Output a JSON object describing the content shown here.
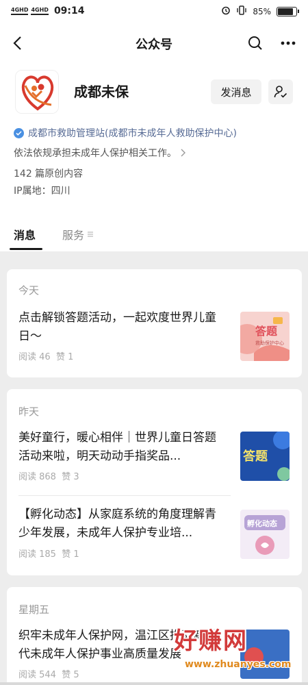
{
  "status": {
    "signal1": "4GHD",
    "signal2": "4GHD",
    "time": "09:14",
    "battery": "85%",
    "battery_level": 0.85
  },
  "nav": {
    "title": "公众号"
  },
  "profile": {
    "name": "成都未保",
    "message_button": "发消息",
    "verified_org": "成都市救助管理站(成都市未成年人救助保护中心)",
    "description": "依法依规承担未成年人保护相关工作。",
    "original_count": "142 篇原创内容",
    "ip_location": "IP属地：四川"
  },
  "tabs": [
    {
      "label": "消息"
    },
    {
      "label": "服务"
    }
  ],
  "sections": [
    {
      "day": "今天",
      "articles": [
        {
          "title": "点击解锁答题活动，一起欢度世界儿童日～",
          "reads": "阅读 46",
          "likes": "赞 1",
          "thumb_text": "答题",
          "thumb_sub": "救助保护中心"
        }
      ]
    },
    {
      "day": "昨天",
      "articles": [
        {
          "title": "美好童行，暖心相伴｜世界儿童日答题活动来啦，明天动动手指奖品...",
          "reads": "阅读 868",
          "likes": "赞 3",
          "thumb_text": "答题"
        },
        {
          "title": "【孵化动态】从家庭系统的角度理解青少年发展，未成年人保护专业培...",
          "reads": "阅读 185",
          "likes": "赞 1",
          "thumb_text": "孵化动态"
        }
      ]
    },
    {
      "day": "星期五",
      "articles": [
        {
          "title": "织牢未成年人保护网，温江区推动新时代未成年人保护事业高质量发展",
          "reads": "阅读 544",
          "likes": "赞 5"
        }
      ]
    }
  ],
  "watermark": {
    "text": "好赚网",
    "url": "www.zhuanyes.com"
  },
  "colors": {
    "link_blue": "#576b95",
    "verify_blue": "#4a90e2",
    "page_bg": "#ededed"
  }
}
